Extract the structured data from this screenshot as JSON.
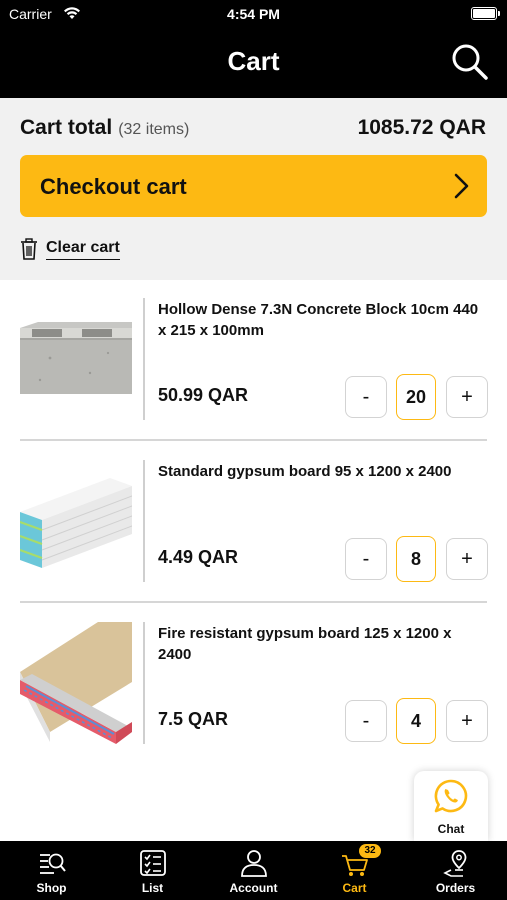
{
  "status": {
    "carrier": "Carrier",
    "time": "4:54 PM"
  },
  "header": {
    "title": "Cart",
    "search_icon": "search-icon"
  },
  "summary": {
    "total_label": "Cart total",
    "items_count": "(32 items)",
    "total_amount": "1085.72 QAR",
    "checkout_label": "Checkout cart",
    "clear_label": "Clear cart"
  },
  "items": [
    {
      "name": "Hollow Dense 7.3N Concrete Block 10cm 440 x 215 x 100mm",
      "price": "50.99 QAR",
      "qty": "20",
      "minus": "-",
      "plus": "+"
    },
    {
      "name": "Standard gypsum board  95 x 1200 x 2400",
      "price": "4.49 QAR",
      "qty": "8",
      "minus": "-",
      "plus": "+"
    },
    {
      "name": "Fire resistant gypsum board  125 x 1200 x 2400",
      "price": "7.5 QAR",
      "qty": "4",
      "minus": "-",
      "plus": "+"
    }
  ],
  "chat": {
    "label": "Chat"
  },
  "nav": {
    "items": [
      {
        "label": "Shop",
        "icon": "shop-search-icon"
      },
      {
        "label": "List",
        "icon": "checklist-icon"
      },
      {
        "label": "Account",
        "icon": "account-icon"
      },
      {
        "label": "Cart",
        "icon": "cart-icon",
        "badge": "32"
      },
      {
        "label": "Orders",
        "icon": "orders-location-icon"
      }
    ]
  },
  "colors": {
    "accent": "#fdb913",
    "bar": "#000000",
    "summary_bg": "#f1f1f1",
    "whatsapp": "#fdb913"
  }
}
